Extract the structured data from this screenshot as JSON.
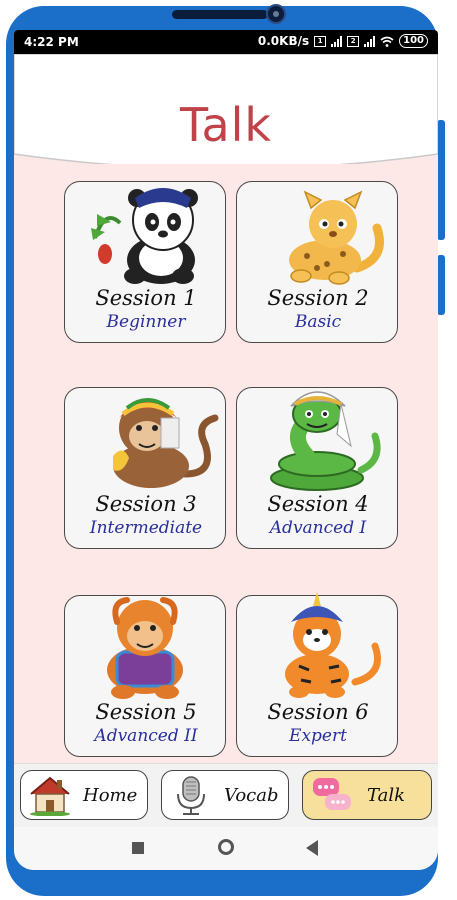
{
  "status": {
    "time": "4:22 PM",
    "speed": "0.0KB/s",
    "sim1": "1",
    "sim2": "2",
    "battery": "100"
  },
  "header": {
    "title": "Talk"
  },
  "sessions": [
    {
      "label": "Session 1",
      "level": "Beginner",
      "icon": "panda-icon"
    },
    {
      "label": "Session 2",
      "level": "Basic",
      "icon": "leopard-icon"
    },
    {
      "label": "Session 3",
      "level": "Intermediate",
      "icon": "monkey-icon"
    },
    {
      "label": "Session 4",
      "level": "Advanced I",
      "icon": "snake-icon"
    },
    {
      "label": "Session 5",
      "level": "Advanced II",
      "icon": "orangutan-icon"
    },
    {
      "label": "Session 6",
      "level": "Expert",
      "icon": "tiger-icon"
    }
  ],
  "tabs": [
    {
      "label": "Home",
      "icon": "house-icon",
      "active": false
    },
    {
      "label": "Vocab",
      "icon": "microphone-icon",
      "active": false
    },
    {
      "label": "Talk",
      "icon": "chat-bubbles-icon",
      "active": true
    }
  ],
  "colors": {
    "frame": "#1b6fc8",
    "background": "#fde7e7",
    "title": "#c0434a",
    "level_text": "#2a2f9a",
    "active_tab": "#f7df9c"
  }
}
